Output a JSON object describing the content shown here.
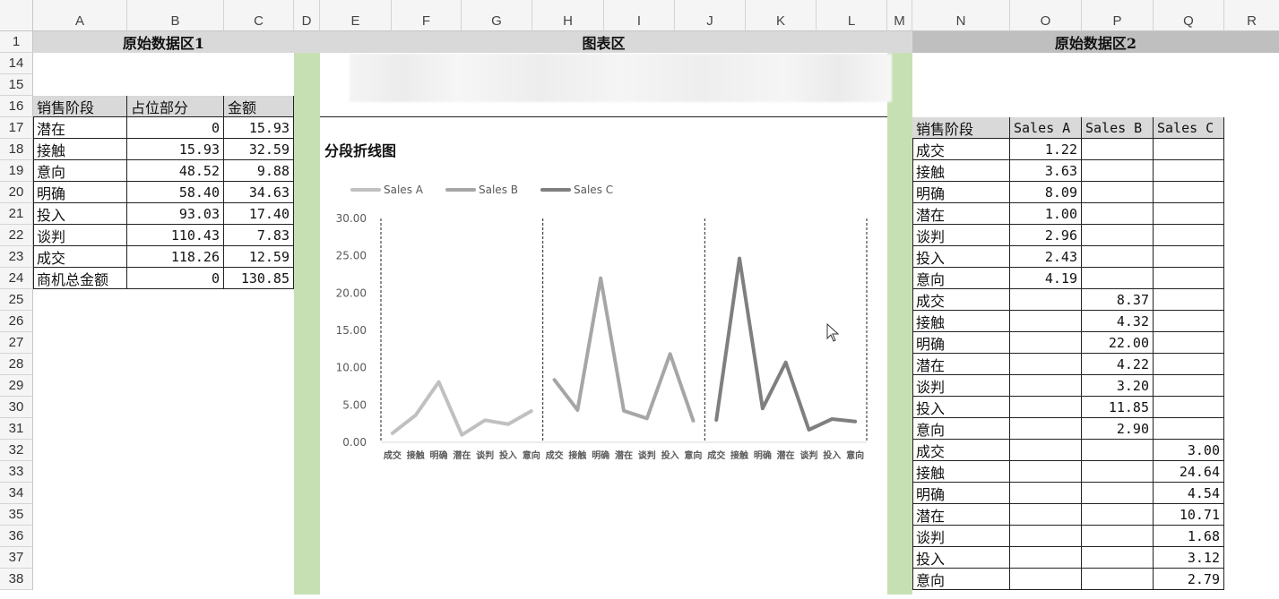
{
  "columns": [
    "A",
    "B",
    "C",
    "D",
    "E",
    "F",
    "G",
    "H",
    "I",
    "J",
    "K",
    "L",
    "M",
    "N",
    "O",
    "P",
    "Q",
    "R"
  ],
  "rows": [
    "1",
    "14",
    "15",
    "16",
    "17",
    "18",
    "19",
    "20",
    "21",
    "22",
    "23",
    "24",
    "25",
    "26",
    "27",
    "28",
    "29",
    "30",
    "31",
    "32",
    "33",
    "34",
    "35",
    "36",
    "37",
    "38"
  ],
  "sections": {
    "raw1": "原始数据区1",
    "chart": "图表区",
    "raw2": "原始数据区2"
  },
  "table1": {
    "headers": [
      "销售阶段",
      "占位部分",
      "金额"
    ],
    "rows": [
      [
        "潜在",
        "0",
        "15.93"
      ],
      [
        "接触",
        "15.93",
        "32.59"
      ],
      [
        "意向",
        "48.52",
        "9.88"
      ],
      [
        "明确",
        "58.40",
        "34.63"
      ],
      [
        "投入",
        "93.03",
        "17.40"
      ],
      [
        "谈判",
        "110.43",
        "7.83"
      ],
      [
        "成交",
        "118.26",
        "12.59"
      ],
      [
        "商机总金额",
        "0",
        "130.85"
      ]
    ]
  },
  "table2": {
    "headers": [
      "销售阶段",
      "Sales A",
      "Sales B",
      "Sales C"
    ],
    "rows": [
      [
        "成交",
        "1.22",
        "",
        ""
      ],
      [
        "接触",
        "3.63",
        "",
        ""
      ],
      [
        "明确",
        "8.09",
        "",
        ""
      ],
      [
        "潜在",
        "1.00",
        "",
        ""
      ],
      [
        "谈判",
        "2.96",
        "",
        ""
      ],
      [
        "投入",
        "2.43",
        "",
        ""
      ],
      [
        "意向",
        "4.19",
        "",
        ""
      ],
      [
        "成交",
        "",
        "8.37",
        ""
      ],
      [
        "接触",
        "",
        "4.32",
        ""
      ],
      [
        "明确",
        "",
        "22.00",
        ""
      ],
      [
        "潜在",
        "",
        "4.22",
        ""
      ],
      [
        "谈判",
        "",
        "3.20",
        ""
      ],
      [
        "投入",
        "",
        "11.85",
        ""
      ],
      [
        "意向",
        "",
        "2.90",
        ""
      ],
      [
        "成交",
        "",
        "",
        "3.00"
      ],
      [
        "接触",
        "",
        "",
        "24.64"
      ],
      [
        "明确",
        "",
        "",
        "4.54"
      ],
      [
        "潜在",
        "",
        "",
        "10.71"
      ],
      [
        "谈判",
        "",
        "",
        "1.68"
      ],
      [
        "投入",
        "",
        "",
        "3.12"
      ],
      [
        "意向",
        "",
        "",
        "2.79"
      ]
    ]
  },
  "colors": {
    "header_grey": "#d9d9d9",
    "separator_green": "#c6e0b4",
    "series_a": "#c0c0c0",
    "series_b": "#a6a6a6",
    "series_c": "#7f7f7f"
  },
  "chart_data": {
    "type": "line",
    "title": "分段折线图",
    "legend_position": "top-left",
    "ylim": [
      0,
      30
    ],
    "yticks": [
      "0.00",
      "5.00",
      "10.00",
      "15.00",
      "20.00",
      "25.00",
      "30.00"
    ],
    "categories": [
      "成交",
      "接触",
      "明确",
      "潜在",
      "谈判",
      "投入",
      "意向",
      "成交",
      "接触",
      "明确",
      "潜在",
      "谈判",
      "投入",
      "意向",
      "成交",
      "接触",
      "明确",
      "潜在",
      "谈判",
      "投入",
      "意向"
    ],
    "series": [
      {
        "name": "Sales A",
        "values": [
          1.22,
          3.63,
          8.09,
          1.0,
          2.96,
          2.43,
          4.19,
          null,
          null,
          null,
          null,
          null,
          null,
          null,
          null,
          null,
          null,
          null,
          null,
          null,
          null
        ]
      },
      {
        "name": "Sales B",
        "values": [
          null,
          null,
          null,
          null,
          null,
          null,
          null,
          8.37,
          4.32,
          22.0,
          4.22,
          3.2,
          11.85,
          2.9,
          null,
          null,
          null,
          null,
          null,
          null,
          null
        ]
      },
      {
        "name": "Sales C",
        "values": [
          null,
          null,
          null,
          null,
          null,
          null,
          null,
          null,
          null,
          null,
          null,
          null,
          null,
          null,
          3.0,
          24.64,
          4.54,
          10.71,
          1.68,
          3.12,
          2.79
        ]
      }
    ],
    "grid": false,
    "segment_dividers": true
  }
}
